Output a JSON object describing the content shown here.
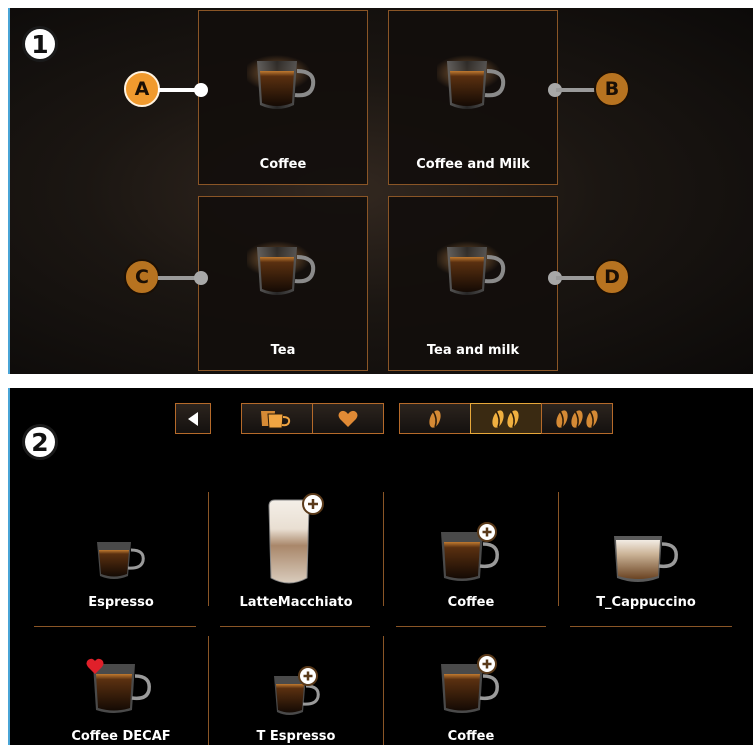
{
  "panel1": {
    "step": "1",
    "tiles": [
      {
        "label": "Coffee"
      },
      {
        "label": "Coffee and Milk"
      },
      {
        "label": "Tea"
      },
      {
        "label": "Tea  and milk"
      }
    ],
    "callouts": [
      {
        "letter": "A",
        "state": "active"
      },
      {
        "letter": "B",
        "state": "muted"
      },
      {
        "letter": "C",
        "state": "muted"
      },
      {
        "letter": "D",
        "state": "muted"
      }
    ]
  },
  "panel2": {
    "step": "2",
    "toolbar": {
      "back": "back-arrow-icon",
      "filters": [
        "cups-icon",
        "heart-icon"
      ],
      "strength": [
        "one-bean-icon",
        "two-beans-icon",
        "three-beans-icon"
      ],
      "strength_selected": 2
    },
    "drinks": [
      {
        "label": "Espresso",
        "plus": false,
        "favorite": false
      },
      {
        "label": "LatteMacchiato",
        "plus": true,
        "favorite": false
      },
      {
        "label": "Coffee",
        "plus": true,
        "favorite": false
      },
      {
        "label": "T_Cappuccino",
        "plus": false,
        "favorite": false
      },
      {
        "label": "Coffee DECAF",
        "plus": false,
        "favorite": true
      },
      {
        "label": "T  Espresso",
        "plus": true,
        "favorite": false
      },
      {
        "label": "Coffee",
        "plus": true,
        "favorite": false
      }
    ]
  },
  "colors": {
    "accent": "#f09a2e",
    "tile_border": "#8a5526",
    "favorite": "#e0202a"
  }
}
